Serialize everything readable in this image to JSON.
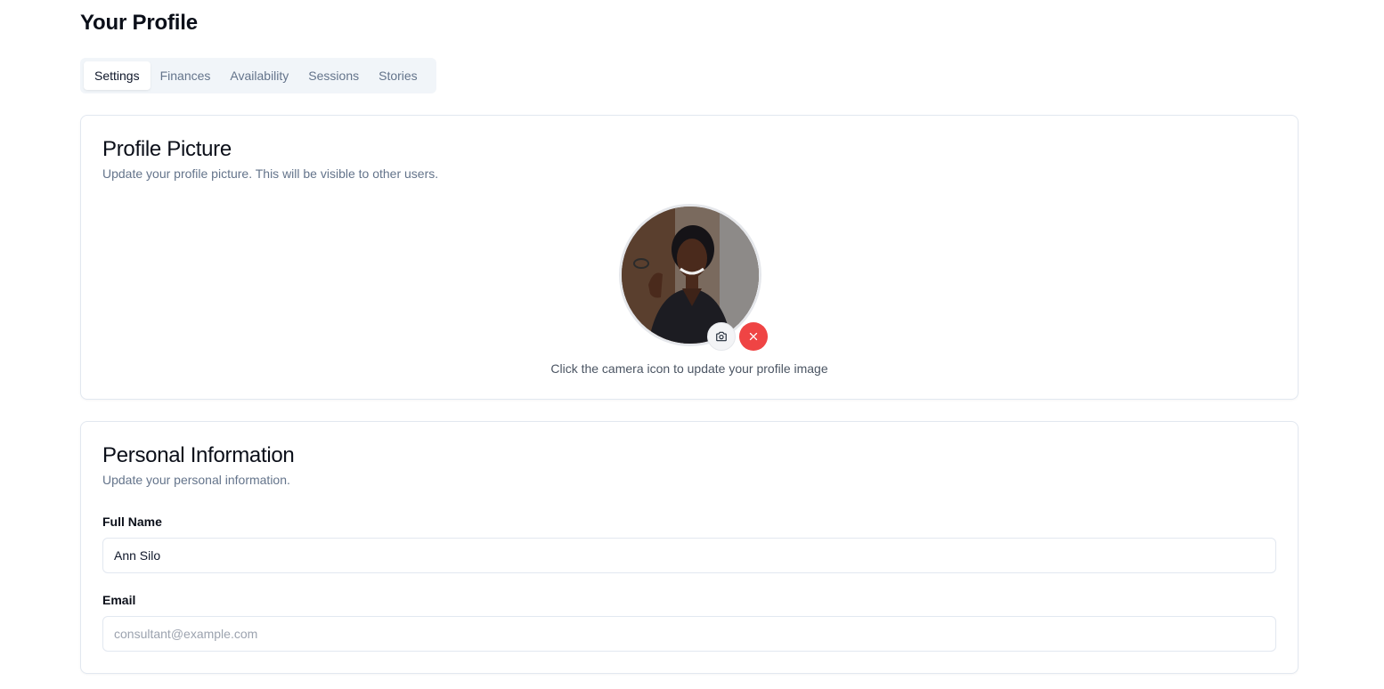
{
  "page": {
    "title": "Your Profile"
  },
  "tabs": [
    {
      "label": "Settings",
      "active": true
    },
    {
      "label": "Finances",
      "active": false
    },
    {
      "label": "Availability",
      "active": false
    },
    {
      "label": "Sessions",
      "active": false
    },
    {
      "label": "Stories",
      "active": false
    }
  ],
  "profile_picture": {
    "title": "Profile Picture",
    "description": "Update your profile picture. This will be visible to other users.",
    "hint": "Click the camera icon to update your profile image",
    "camera_icon": "camera-icon",
    "remove_icon": "close-icon"
  },
  "personal_info": {
    "title": "Personal Information",
    "description": "Update your personal information.",
    "full_name_label": "Full Name",
    "full_name_value": "Ann Silo",
    "email_label": "Email",
    "email_placeholder": "consultant@example.com"
  },
  "colors": {
    "danger": "#ef4444",
    "muted_text": "#64748b",
    "border": "#e2e8f0",
    "tab_bg": "#f1f5f9"
  }
}
